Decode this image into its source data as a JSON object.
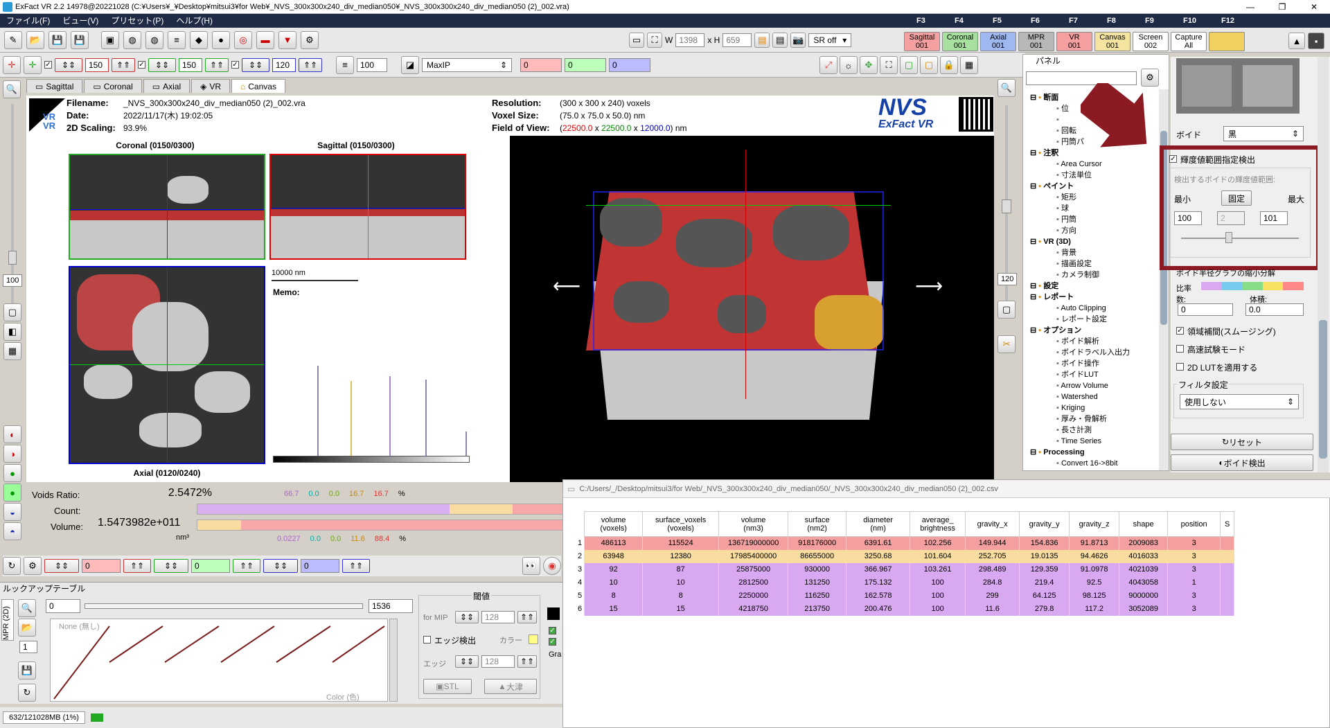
{
  "window": {
    "title": "ExFact VR 2.2 14978@20221028 (C:¥Users¥_¥Desktop¥mitsui3¥for Web¥_NVS_300x300x240_div_median050¥_NVS_300x300x240_div_median050 (2)_002.vra)"
  },
  "menu": [
    "ファイル(F)",
    "ビュー(V)",
    "プリセット(P)",
    "ヘルプ(H)"
  ],
  "fkeys": [
    {
      "key": "F3",
      "label": "Sagittal\n001",
      "color": "#f4a0a0"
    },
    {
      "key": "F4",
      "label": "Coronal\n001",
      "color": "#a8e0a0"
    },
    {
      "key": "F5",
      "label": "Axial\n001",
      "color": "#a0b8f0"
    },
    {
      "key": "F6",
      "label": "MPR\n001",
      "color": "#b8b8b8"
    },
    {
      "key": "F7",
      "label": "VR\n001",
      "color": "#f4a0a0"
    },
    {
      "key": "F8",
      "label": "Canvas\n001",
      "color": "#f4e4a0"
    },
    {
      "key": "F9",
      "label": "Screen\n002",
      "color": "#ffffff"
    },
    {
      "key": "F10",
      "label": "Capture\nAll",
      "color": "#ffffff"
    },
    {
      "key": "F12",
      "label": "",
      "color": "#f0d060"
    }
  ],
  "toolbar1": {
    "w_label": "W",
    "w_value": "1398",
    "h_label": "x H",
    "h_value": "659",
    "sr": "SR off"
  },
  "toolbar2": {
    "v1": "150",
    "v2": "150",
    "v3": "120",
    "thick": "100",
    "mode": "MaxIP",
    "c1": "0",
    "c2": "0",
    "c3": "0"
  },
  "tabs": [
    "Sagittal",
    "Coronal",
    "Axial",
    "VR",
    "Canvas"
  ],
  "left_slider": {
    "top_value": "100",
    "bottom_value": "120"
  },
  "info": {
    "filename_label": "Filename:",
    "filename": "_NVS_300x300x240_div_median050 (2)_002.vra",
    "date_label": "Date:",
    "date": "2022/11/17(木) 19:02:05",
    "scaling_label": "2D Scaling:",
    "scaling": "93.9%",
    "res_label": "Resolution:",
    "res": "(300 x 300 x 240) voxels",
    "voxel_label": "Voxel Size:",
    "voxel": "(75.0 x 75.0 x 50.0) nm",
    "fov_label": "Field of View:",
    "fov_x": "22500.0",
    "fov_y": "22500.0",
    "fov_z": "12000.0",
    "fov_unit": "nm",
    "logo": "NVS",
    "logo_sub": "ExFact VR"
  },
  "views": {
    "coronal": "Coronal (0150/0300)",
    "sagittal": "Sagittal (0150/0300)",
    "axial": "Axial (0120/0240)",
    "scale": "10000 nm",
    "memo": "Memo:"
  },
  "voids": {
    "ratio_label": "Voids Ratio:",
    "ratio": "2.5472%",
    "count_label": "Count:",
    "count": "6",
    "volume_label": "Volume:",
    "volume": "1.5473982e+011",
    "volume_unit": "nm³",
    "pct1": [
      "66.7",
      "0.0",
      "0.0",
      "16.7",
      "16.7",
      "%"
    ],
    "pct2": [
      "0.0227",
      "0.0",
      "0.0",
      "11.6",
      "88.4",
      "%"
    ],
    "bar1": [
      66.7,
      16.7,
      16.7
    ],
    "bar2": [
      11.6,
      88.4
    ]
  },
  "bottom_toolbar": {
    "v1": "0",
    "v2": "0",
    "v3": "0"
  },
  "lut": {
    "title": "ルックアップテーブル",
    "min": "0",
    "max": "1536",
    "threshold_label": "閾値",
    "mip_label": "for MIP",
    "mip_value": "128",
    "edge_label": "エッジ検出",
    "color_label": "カラー",
    "edge2_label": "エッジ",
    "edge2_value": "128",
    "stl": "STL",
    "otsu": "大津",
    "none_label": "None (無し)",
    "color_axis": "Color (色)",
    "side_tab": "MPR (2D)",
    "side_num": "1",
    "gra": "Gra"
  },
  "status": {
    "memory": "632/121028MB (1%)"
  },
  "csv": {
    "path": "C:/Users/_/Desktop/mitsui3/for Web/_NVS_300x300x240_div_median050/_NVS_300x300x240_div_median050 (2)_002.csv",
    "headers": [
      "volume\n(voxels)",
      "surface_voxels\n(voxels)",
      "volume\n(nm3)",
      "surface\n(nm2)",
      "diameter\n(nm)",
      "average_\nbrightness",
      "gravity_x",
      "gravity_y",
      "gravity_z",
      "shape",
      "position",
      "S"
    ],
    "rows": [
      {
        "n": "1",
        "cells": [
          "486113",
          "115524",
          "136719000000",
          "918176000",
          "6391.61",
          "102.256",
          "149.944",
          "154.836",
          "91.8713",
          "2009083",
          "3"
        ],
        "color": "#f4a0a0"
      },
      {
        "n": "2",
        "cells": [
          "63948",
          "12380",
          "17985400000",
          "86655000",
          "3250.68",
          "101.604",
          "252.705",
          "19.0135",
          "94.4626",
          "4016033",
          "3"
        ],
        "color": "#f8dca0"
      },
      {
        "n": "3",
        "cells": [
          "92",
          "87",
          "25875000",
          "930000",
          "366.967",
          "103.261",
          "298.489",
          "129.359",
          "91.0978",
          "4021039",
          "3"
        ],
        "color": "#d8a8f0"
      },
      {
        "n": "4",
        "cells": [
          "10",
          "10",
          "2812500",
          "131250",
          "175.132",
          "100",
          "284.8",
          "219.4",
          "92.5",
          "4043058",
          "1"
        ],
        "color": "#d8a8f0"
      },
      {
        "n": "5",
        "cells": [
          "8",
          "8",
          "2250000",
          "116250",
          "162.578",
          "100",
          "299",
          "64.125",
          "98.125",
          "9000000",
          "3"
        ],
        "color": "#d8a8f0"
      },
      {
        "n": "6",
        "cells": [
          "15",
          "15",
          "4218750",
          "213750",
          "200.476",
          "100",
          "11.6",
          "279.8",
          "117.2",
          "3052089",
          "3"
        ],
        "color": "#d8a8f0"
      }
    ]
  },
  "tree": {
    "panel_title": "パネル",
    "items": [
      {
        "t": "断面",
        "h": true
      },
      {
        "t": "位"
      },
      {
        "t": ""
      },
      {
        "t": "回転"
      },
      {
        "t": "円筒パ"
      },
      {
        "t": "注釈",
        "h": true
      },
      {
        "t": "Area Cursor"
      },
      {
        "t": "寸法単位"
      },
      {
        "t": "ペイント",
        "h": true
      },
      {
        "t": "矩形"
      },
      {
        "t": "球"
      },
      {
        "t": "円筒"
      },
      {
        "t": "方向"
      },
      {
        "t": "VR (3D)",
        "h": true
      },
      {
        "t": "背景"
      },
      {
        "t": "描画設定"
      },
      {
        "t": "カメラ制御"
      },
      {
        "t": "設定",
        "h": true
      },
      {
        "t": "レポート",
        "h": true
      },
      {
        "t": "Auto Clipping"
      },
      {
        "t": "レポート設定"
      },
      {
        "t": "オプション",
        "h": true
      },
      {
        "t": "ボイド解析"
      },
      {
        "t": "ボイドラベル入出力"
      },
      {
        "t": "ボイド操作"
      },
      {
        "t": "ボイドLUT"
      },
      {
        "t": "Arrow Volume"
      },
      {
        "t": "Watershed"
      },
      {
        "t": "Kriging"
      },
      {
        "t": "厚み・骨解析"
      },
      {
        "t": "長さ計測"
      },
      {
        "t": "Time Series"
      },
      {
        "t": "Processing",
        "h": true
      },
      {
        "t": "Convert 16->8bit"
      }
    ]
  },
  "void_panel": {
    "void_label": "ボイド",
    "void_value": "黒",
    "range_check": "輝度値範囲指定検出",
    "range_title": "検出するボイドの輝度値範囲:",
    "min_label": "最小",
    "fixed_label": "固定",
    "max_label": "最大",
    "min_value": "100",
    "mid_value": "2",
    "max_value": "101",
    "graph_label": "ボイド半径グラフの縮小分解",
    "ratio_label": "比率",
    "count_label": "数:",
    "vol_label": "体積:",
    "count_value": "0",
    "vol_value": "0.0",
    "smooth": "領域補間(スムージング)",
    "fast": "高速試験モード",
    "lut2d": "2D LUTを適用する",
    "filter_label": "フィルタ設定",
    "filter_value": "使用しない",
    "reset": "リセット",
    "detect": "ボイド検出"
  }
}
